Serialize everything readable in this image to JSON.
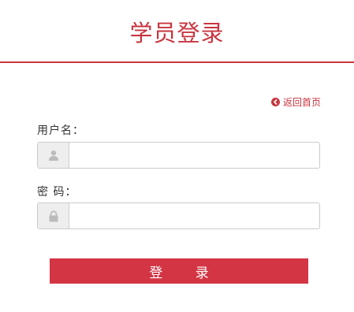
{
  "header": {
    "title": "学员登录"
  },
  "back_link": {
    "label": "返回首页",
    "icon": "arrow-left-circle-icon"
  },
  "form": {
    "username": {
      "label": "用户名：",
      "value": "",
      "placeholder": "",
      "icon": "user-icon"
    },
    "password": {
      "label": "密 码：",
      "value": "",
      "placeholder": "",
      "icon": "lock-icon"
    },
    "submit_label": "登 录"
  },
  "colors": {
    "accent": "#c8353f",
    "button": "#d33545",
    "addon_bg": "#eeeeee",
    "addon_icon": "#bbbbbb"
  }
}
